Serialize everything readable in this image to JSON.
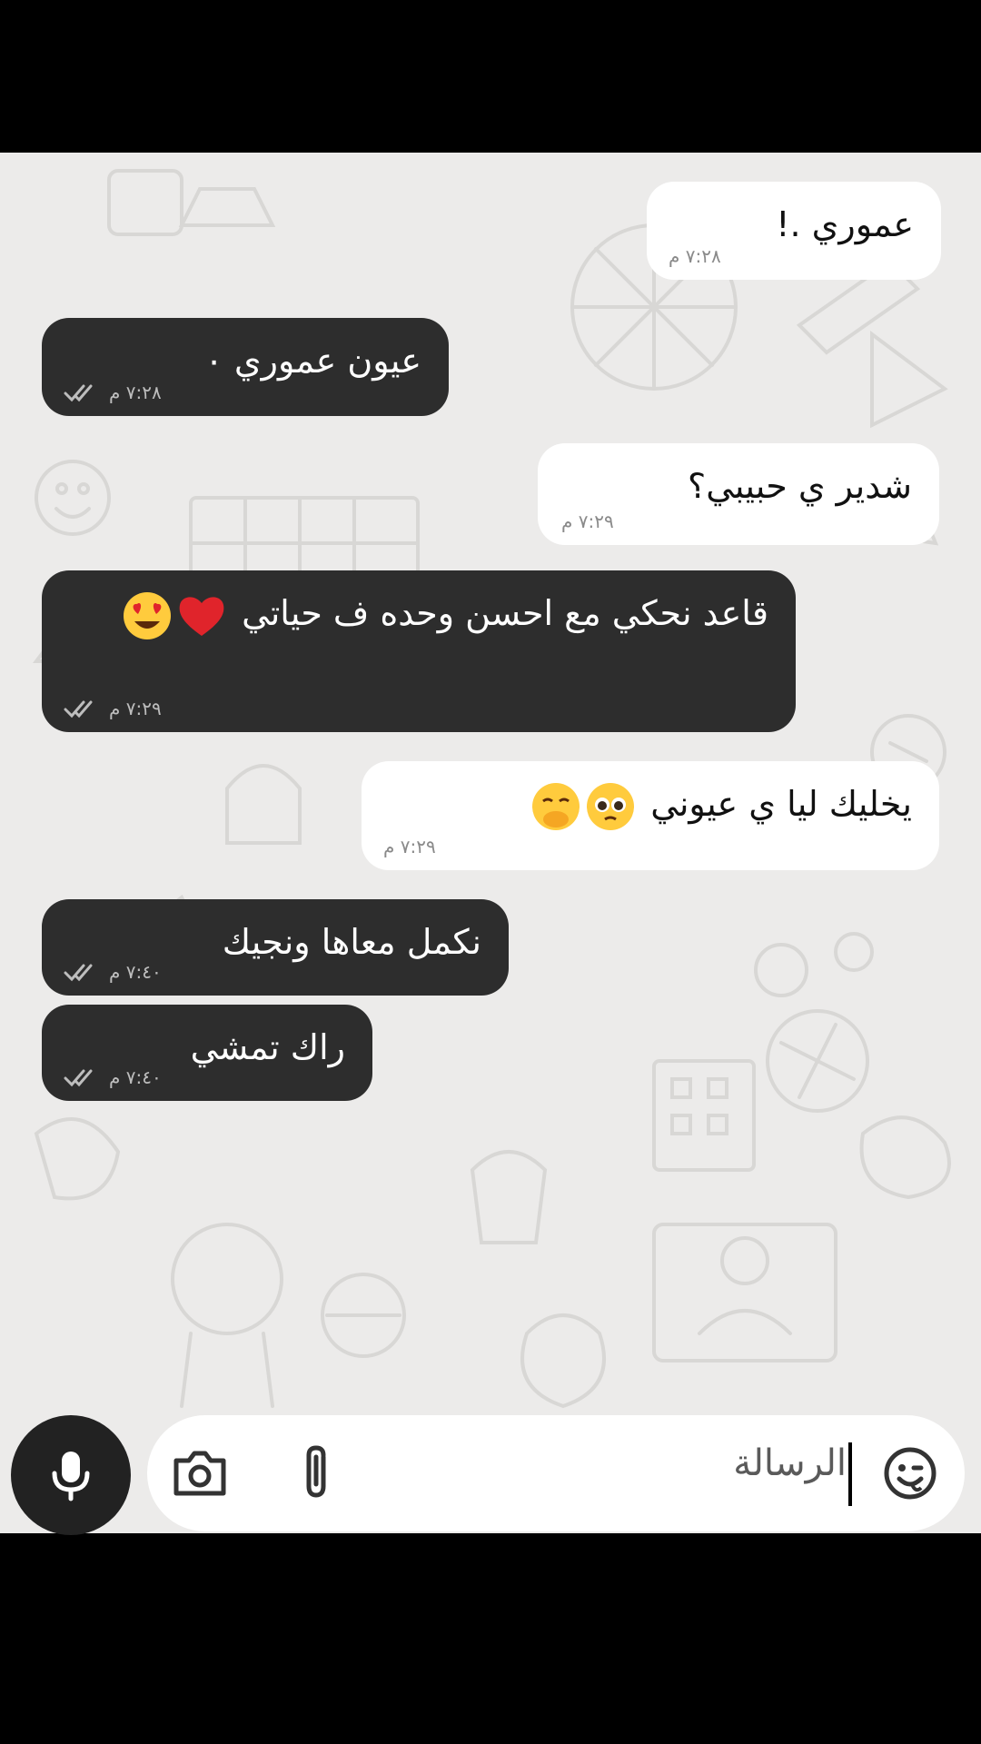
{
  "messages": [
    {
      "side": "in",
      "text": "عموري .!",
      "time": "٧:٢٨ م"
    },
    {
      "side": "out",
      "text": "عيون عموري ٠",
      "time": "٧:٢٨ م"
    },
    {
      "side": "in",
      "text": "شدير ي حبيبي؟",
      "time": "٧:٢٩ م"
    },
    {
      "side": "out",
      "text": "قاعد نحكي مع احسن وحده ف حياتي",
      "emojis": [
        "red-heart",
        "heart-eyes-face"
      ],
      "time": "٧:٢٩ م"
    },
    {
      "side": "in",
      "text": "يخليك ليا ي عيوني",
      "emojis": [
        "pleading-face",
        "hand-over-mouth-face"
      ],
      "time": "٧:٢٩ م"
    },
    {
      "side": "out",
      "text": "نكمل معاها ونجيك",
      "time": "٧:٤٠ م"
    },
    {
      "side": "out",
      "text": "راك تمشي",
      "time": "٧:٤٠ م"
    }
  ],
  "composer": {
    "placeholder": "الرسالة"
  },
  "colors": {
    "incoming_bubble": "#ffffff",
    "outgoing_bubble": "#2d2d2d",
    "wallpaper": "#ecebea"
  },
  "icons": [
    "mic-icon",
    "camera-icon",
    "paperclip-icon",
    "sticker-icon",
    "double-check-icon"
  ]
}
